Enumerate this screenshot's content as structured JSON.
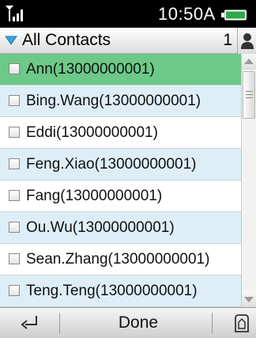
{
  "status": {
    "time": "10:50A",
    "signal_icon": "signal-icon",
    "battery_icon": "battery-icon"
  },
  "header": {
    "title": "All Contacts",
    "count": "1",
    "dropdown_icon": "chevron-down-icon",
    "contact_icon": "person-icon"
  },
  "contacts": [
    {
      "label": "Ann(13000000001)",
      "selected": true
    },
    {
      "label": "Bing.Wang(13000000001)",
      "selected": false
    },
    {
      "label": "Eddi(13000000001)",
      "selected": false
    },
    {
      "label": "Feng.Xiao(13000000001)",
      "selected": false
    },
    {
      "label": "Fang(13000000001)",
      "selected": false
    },
    {
      "label": "Ou.Wu(13000000001)",
      "selected": false
    },
    {
      "label": "Sean.Zhang(13000000001)",
      "selected": false
    },
    {
      "label": "Teng.Teng(13000000001)",
      "selected": false
    }
  ],
  "footer": {
    "done_label": "Done",
    "back_icon": "back-icon",
    "home_icon": "home-icon"
  },
  "colors": {
    "selected_row": "#6cc987",
    "alt_row": "#deeef7",
    "row": "#ffffff",
    "caret": "#35a7dd"
  }
}
